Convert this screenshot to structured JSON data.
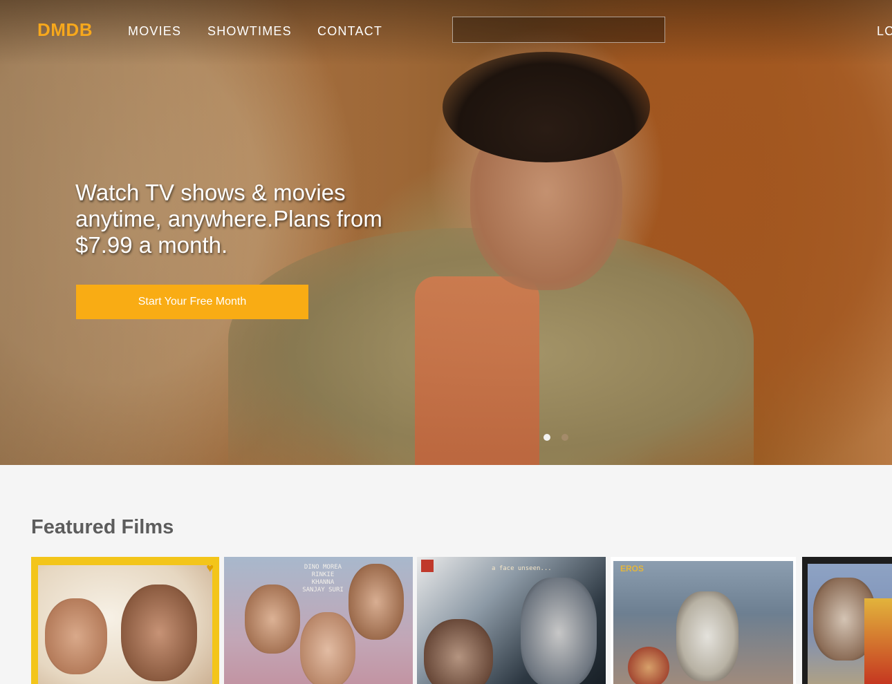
{
  "nav": {
    "logo": "DMDB",
    "links": [
      "MOVIES",
      "SHOWTIMES",
      "CONTACT"
    ],
    "search_value": "",
    "login_label": "LC"
  },
  "hero": {
    "tagline": "Watch TV shows & movies anytime, anywhere.Plans from $7.99 a month.",
    "cta_label": "Start Your Free Month",
    "carousel": {
      "slides": 2,
      "active_index": 0
    }
  },
  "featured": {
    "title": "Featured Films",
    "posters": [
      {
        "icon": "heart-icon",
        "text": ""
      },
      {
        "text": "DINO MOREA  RINKIE KHANNA  SANJAY SURI"
      },
      {
        "text": "a face unseen..."
      },
      {
        "text": "EROS"
      },
      {
        "text": ""
      }
    ]
  },
  "colors": {
    "accent": "#f9ac14",
    "logo": "#f7a81c",
    "section_title": "#5c5c5c",
    "page_bg": "#f5f5f5"
  }
}
